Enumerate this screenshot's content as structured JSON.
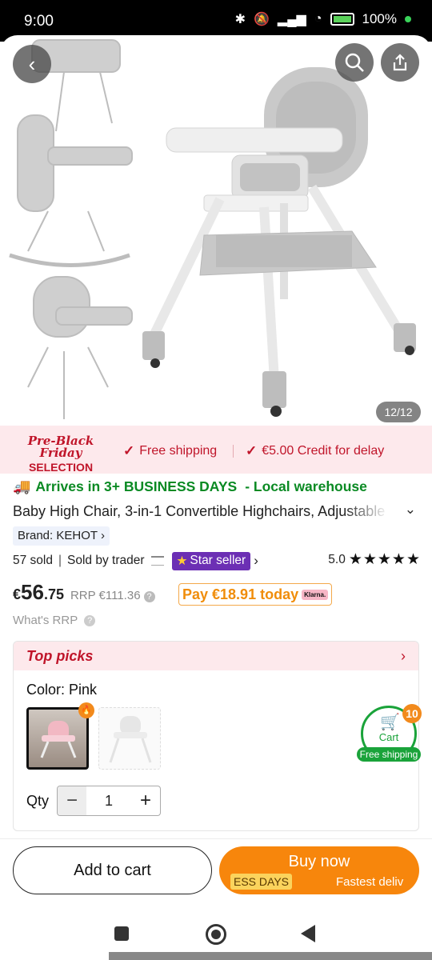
{
  "status_bar": {
    "time": "9:00",
    "battery": "100%"
  },
  "gallery": {
    "counter": "12/12"
  },
  "promo": {
    "badge_line1": "Pre-Black Friday",
    "badge_line2": "SELECTION",
    "free_shipping": "Free shipping",
    "credit_delay": "€5.00 Credit for delay"
  },
  "delivery": {
    "text": "Arrives in 3+ BUSINESS DAYS",
    "suffix": "- Local warehouse"
  },
  "product": {
    "title": "Baby High Chair, 3-in-1 Convertible Highchairs, Adjustable",
    "brand": "Brand: KEHOT",
    "sold": "57 sold",
    "sold_by": "Sold by trader",
    "star_seller": "Star seller",
    "rating": "5.0",
    "stars": 5
  },
  "price": {
    "currency": "€",
    "int": "56",
    "dec": ".75",
    "rrp": "RRP €111.36",
    "pay_today": "Pay €18.91 today",
    "klarna": "Klarna.",
    "what_rrp": "What's RRP"
  },
  "top_picks": {
    "title": "Top picks",
    "color_label": "Color: Pink",
    "qty_label": "Qty",
    "qty_value": "1"
  },
  "cart": {
    "label": "Cart",
    "count": "10",
    "free_shipping": "Free shipping"
  },
  "actions": {
    "add_to_cart": "Add to cart",
    "buy_now": "Buy now",
    "buy_tag": "ESS DAYS",
    "buy_fast": "Fastest deliv"
  },
  "colors": {
    "accent_orange": "#f7860c",
    "green": "#1aa33a",
    "promo_red": "#c0152a",
    "star_seller_purple": "#6c2fb4"
  }
}
